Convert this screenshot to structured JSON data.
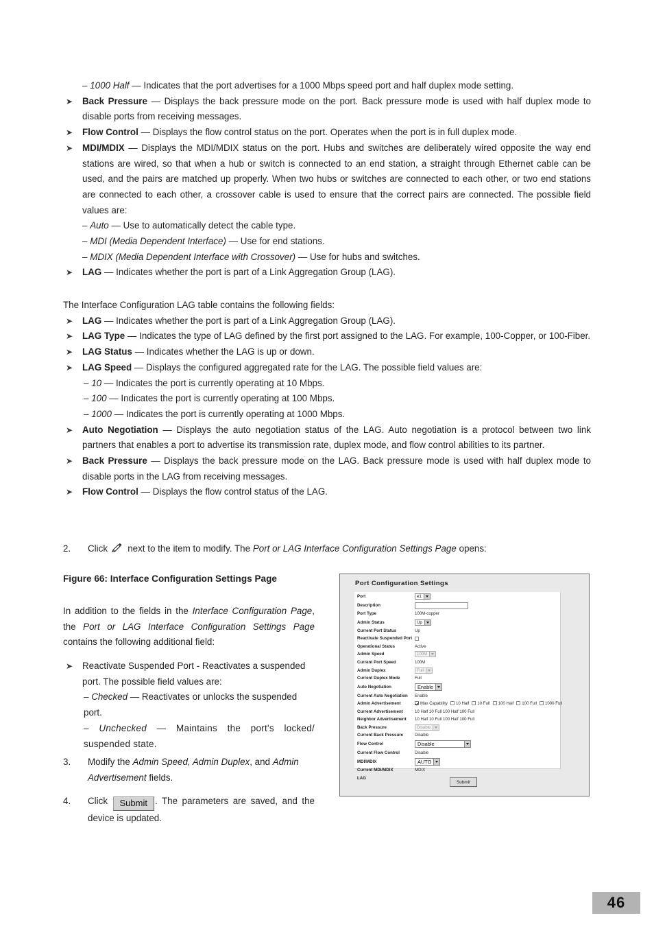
{
  "page": {
    "number": "46"
  },
  "top_list": {
    "sub_1000_half": {
      "dash": "–",
      "term": "1000 Half",
      "dashsep": "—",
      "text": "Indicates that the port advertises for a 1000 Mbps speed port and half duplex mode setting."
    },
    "items": [
      {
        "term": "Back Pressure",
        "sep": "—",
        "text": "Displays the back pressure mode on the port. Back pressure mode is used with half duplex mode to disable ports from receiving messages."
      },
      {
        "term": "Flow Control",
        "sep": "—",
        "text": "Displays the flow control status on the port. Operates when the port is in full duplex mode."
      },
      {
        "term": "MDI/MDIX",
        "sep": "—",
        "text": "Displays the MDI/MDIX status on the port. Hubs and switches are deliberately wired opposite the way end stations are wired, so that when a hub or switch is connected to an end station, a straight through Ethernet cable can be used, and the pairs are matched up properly. When two hubs or switches are connected to each other, or two end stations are connected to each other, a crossover cable is used to ensure that the correct pairs are connected. The possible field values are:"
      }
    ],
    "mdi_values": [
      {
        "dash": "–",
        "term": "Auto",
        "sep": "—",
        "text": "Use to automatically detect the cable type."
      },
      {
        "dash": "–",
        "term": "MDI (Media Dependent Interface)",
        "sep": "—",
        "text": "Use for end stations."
      },
      {
        "dash": "–",
        "term": "MDIX (Media Dependent Interface with Crossover)",
        "sep": "—",
        "text": "Use for hubs and switches."
      }
    ],
    "lag_item": {
      "term": "LAG",
      "sep": "—",
      "text": "Indicates whether the port is part of a Link Aggregation Group (LAG)."
    }
  },
  "lag_section": {
    "intro": "The Interface Configuration LAG table contains the following fields:",
    "items": [
      {
        "term": "LAG",
        "sep": "—",
        "text": "Indicates whether the port is part of a Link Aggregation Group (LAG)."
      },
      {
        "term": "LAG Type",
        "sep": "—",
        "text": "Indicates the type of LAG defined by the first port assigned to the LAG. For example, 100-Copper, or 100-Fiber."
      },
      {
        "term": "LAG Status",
        "sep": "—",
        "text": "Indicates whether the LAG is up or down."
      },
      {
        "term": "LAG Speed",
        "sep": "—",
        "text": "Displays the configured aggregated rate for the LAG. The possible field values are:"
      }
    ],
    "speed_values": [
      {
        "dash": "–",
        "term": "10",
        "sep": "—",
        "text": "Indicates the port is currently operating at 10 Mbps."
      },
      {
        "dash": "–",
        "term": "100",
        "sep": "—",
        "text": "Indicates the port is currently operating at 100 Mbps."
      },
      {
        "dash": "–",
        "term": "1000",
        "sep": "—",
        "text": "Indicates the port is currently operating at 1000 Mbps."
      }
    ],
    "items2": [
      {
        "term": "Auto Negotiation",
        "sep": "—",
        "text": "Displays the auto negotiation status of the LAG. Auto negotiation is a protocol between two link partners that enables a port to advertise its transmission rate, duplex mode, and flow control abilities to its partner."
      },
      {
        "term": "Back Pressure",
        "sep": "—",
        "text": "Displays the back pressure mode on the LAG. Back pressure mode is used with half duplex mode to disable ports in the LAG from receiving messages."
      },
      {
        "term": "Flow Control",
        "sep": "—",
        "text": "Displays the flow control status of the LAG."
      }
    ]
  },
  "steps": {
    "step2": {
      "num": "2.",
      "pre": "Click",
      "icon": "pencil-icon",
      "mid": "next to the item to modify. The",
      "italic": "Port or LAG Interface Configuration Settings Page",
      "post": "opens:"
    },
    "step3": {
      "num": "3.",
      "pre": "Modify the",
      "italic1": "Admin Speed, Admin Duplex",
      "mid": ", and",
      "italic2": "Admin Advertisement",
      "post": "fields."
    },
    "step4": {
      "num": "4.",
      "pre": "Click",
      "button": "Submit",
      "post": ". The parameters are saved, and the device is updated."
    }
  },
  "figure_caption": "Figure 66: Interface Configuration Settings Page",
  "figure_intro": {
    "l1a": "In addition to the fields in the",
    "l1b": "Interface Configuration Page",
    "l1c": ",",
    "l2a": "the",
    "l2b": "Port or LAG Interface Configuration Settings Page",
    "l3": "contains the following additional field:"
  },
  "reactivate": {
    "term": "Reactivate Suspended Port - Reactivates a suspended port. The possible field values are:",
    "values": [
      {
        "dash": "–",
        "term": "Checked",
        "sep": "—",
        "text": "Reactivates or unlocks the suspended port."
      },
      {
        "dash": "–",
        "term": "Unchecked",
        "sep": "—",
        "text": "Maintains the port's locked/ suspended state."
      }
    ]
  },
  "figure": {
    "title": "Port Configuration Settings",
    "submit_label": "Submit",
    "rows": [
      {
        "label": "Port",
        "control": "select",
        "value": "e1"
      },
      {
        "label": "Description",
        "control": "text",
        "value": ""
      },
      {
        "label": "Port Type",
        "control": "static",
        "value": "100M-copper"
      },
      {
        "label": "Admin Status",
        "control": "select",
        "value": "Up"
      },
      {
        "label": "Current Port Status",
        "control": "static",
        "value": "Up"
      },
      {
        "label": "Reactivate Suspended Port",
        "control": "checkbox",
        "value": "unchecked"
      },
      {
        "label": "Operational Status",
        "control": "static",
        "value": "Active"
      },
      {
        "label": "Admin Speed",
        "control": "select-disabled",
        "value": "100M"
      },
      {
        "label": "Current Port Speed",
        "control": "static",
        "value": "100M"
      },
      {
        "label": "Admin Duplex",
        "control": "select-disabled",
        "value": "Full"
      },
      {
        "label": "Current Duplex Mode",
        "control": "static",
        "value": "Full"
      },
      {
        "label": "Auto Negotiation",
        "control": "select-big",
        "value": "Enable"
      },
      {
        "label": "Current Auto Negotiation",
        "control": "static",
        "value": "Enable"
      },
      {
        "label": "Admin Advertisement",
        "control": "checkgroup",
        "value": ""
      },
      {
        "label": "Current Advertisement",
        "control": "static",
        "value": "10 Half 10 Full 100 Half 100 Full"
      },
      {
        "label": "Neighbor Advertisement",
        "control": "static",
        "value": "10 Half 10 Full 100 Half 100 Full"
      },
      {
        "label": "Back Pressure",
        "control": "select-disabled",
        "value": "Disable"
      },
      {
        "label": "Current Back Pressure",
        "control": "static",
        "value": "Disable"
      },
      {
        "label": "Flow Control",
        "control": "select-wide",
        "value": "Disable"
      },
      {
        "label": "Current Flow Control",
        "control": "static",
        "value": "Disable"
      },
      {
        "label": "MDI/MDIX",
        "control": "select-big",
        "value": "AUTO"
      },
      {
        "label": "Current MDI/MDIX",
        "control": "static",
        "value": "MDIX"
      },
      {
        "label": "LAG",
        "control": "static",
        "value": ""
      }
    ],
    "advertisement_options": [
      {
        "label": "Max Capability",
        "checked": true
      },
      {
        "label": "10 Half",
        "checked": false
      },
      {
        "label": "10 Full",
        "checked": false
      },
      {
        "label": "100 Half",
        "checked": false
      },
      {
        "label": "100 Full",
        "checked": false
      },
      {
        "label": "1000 Full",
        "checked": false
      }
    ]
  }
}
